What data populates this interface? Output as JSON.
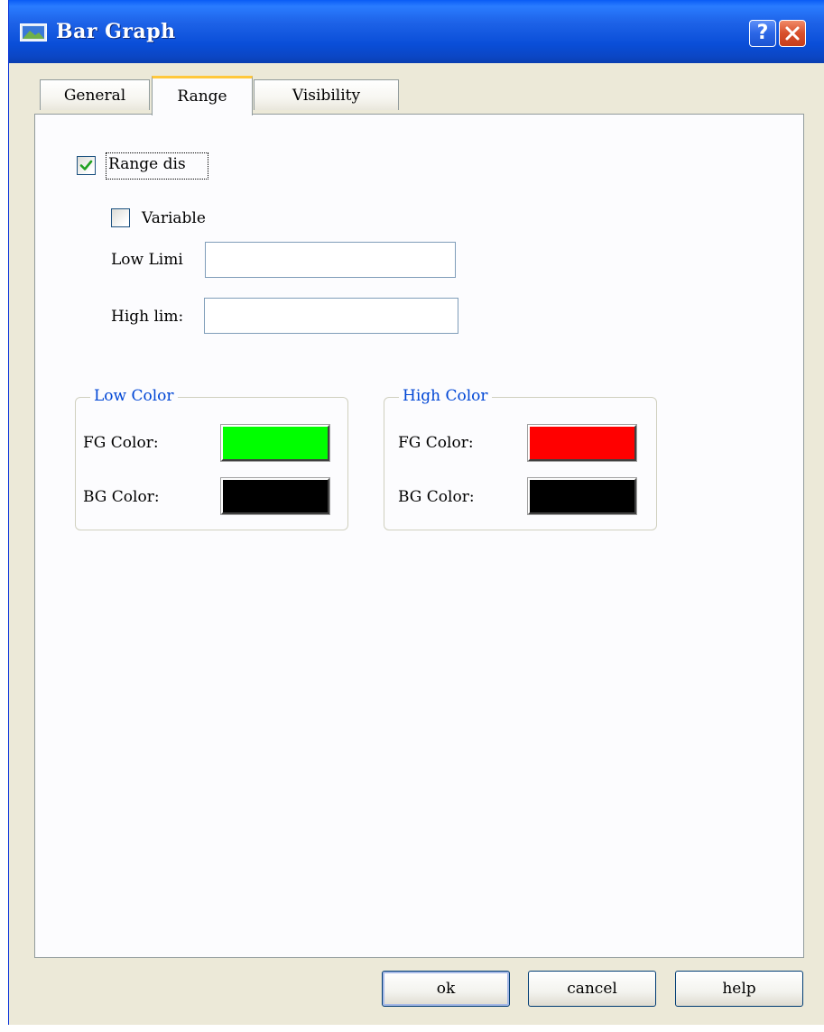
{
  "window": {
    "title": "Bar Graph",
    "help_button_label": "?"
  },
  "tabs": [
    {
      "label": "General",
      "active": false
    },
    {
      "label": "Range",
      "active": true
    },
    {
      "label": "Visibility",
      "active": false
    }
  ],
  "range": {
    "range_display_label": "Range dis",
    "range_display_checked": true,
    "variable_label": "Variable",
    "variable_checked": false,
    "low_limit_label": "Low Limi",
    "low_limit_value": "",
    "high_limit_label": "High lim:",
    "high_limit_value": ""
  },
  "low_color": {
    "title": "Low Color",
    "fg_label": "FG Color:",
    "fg_color": "#00ff00",
    "bg_label": "BG Color:",
    "bg_color": "#000000"
  },
  "high_color": {
    "title": "High Color",
    "fg_label": "FG Color:",
    "fg_color": "#ff0000",
    "bg_label": "BG Color:",
    "bg_color": "#000000"
  },
  "buttons": {
    "ok": "ok",
    "cancel": "cancel",
    "help": "help"
  }
}
